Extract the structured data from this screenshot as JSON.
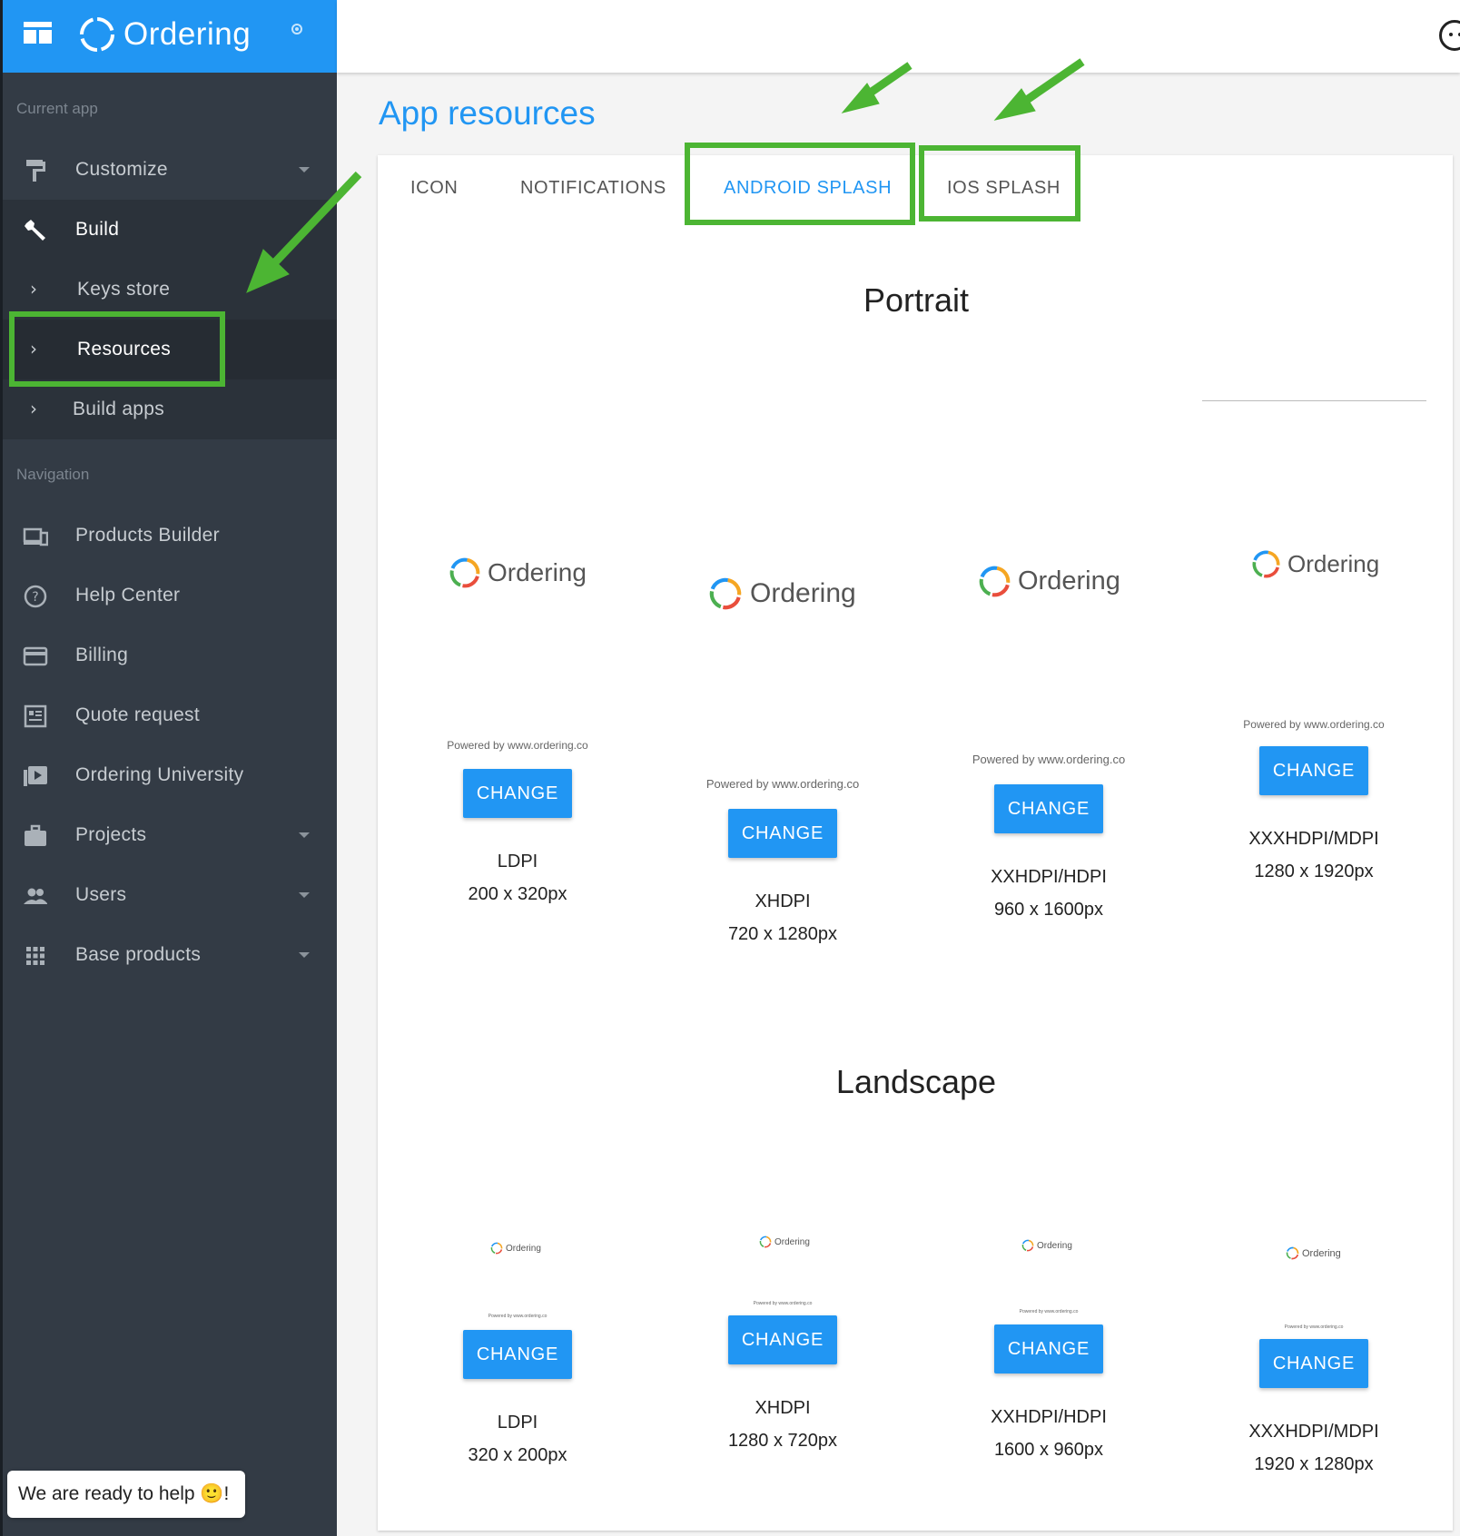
{
  "brand": {
    "name": "Ordering"
  },
  "sidebar": {
    "current_app_label": "Current app",
    "customize": "Customize",
    "build": "Build",
    "build_sub": [
      "Keys store",
      "Resources",
      "Build apps"
    ],
    "navigation_label": "Navigation",
    "nav_items": [
      "Products Builder",
      "Help Center",
      "Billing",
      "Quote request",
      "Ordering University",
      "Projects",
      "Users",
      "Base products"
    ]
  },
  "help_bubble": "We are ready to help 🙂!",
  "page": {
    "title": "App resources"
  },
  "tabs": [
    "ICON",
    "NOTIFICATIONS",
    "ANDROID SPLASH",
    "IOS SPLASH"
  ],
  "active_tab": "ANDROID SPLASH",
  "portrait": {
    "title": "Portrait",
    "tiles": [
      {
        "logo": "Ordering",
        "powered": "Powered by www.ordering.co",
        "button": "CHANGE",
        "density": "LDPI",
        "size": "200 x 320px"
      },
      {
        "logo": "Ordering",
        "powered": "Powered by www.ordering.co",
        "button": "CHANGE",
        "density": "XHDPI",
        "size": "720 x 1280px"
      },
      {
        "logo": "Ordering",
        "powered": "Powered by www.ordering.co",
        "button": "CHANGE",
        "density": "XXHDPI/HDPI",
        "size": "960 x 1600px"
      },
      {
        "logo": "Ordering",
        "powered": "Powered by www.ordering.co",
        "button": "CHANGE",
        "density": "XXXHDPI/MDPI",
        "size": "1280 x 1920px"
      }
    ]
  },
  "landscape": {
    "title": "Landscape",
    "tiles": [
      {
        "logo": "Ordering",
        "powered": "Powered by www.ordering.co",
        "button": "CHANGE",
        "density": "LDPI",
        "size": "320 x 200px"
      },
      {
        "logo": "Ordering",
        "powered": "Powered by www.ordering.co",
        "button": "CHANGE",
        "density": "XHDPI",
        "size": "1280 x 720px"
      },
      {
        "logo": "Ordering",
        "powered": "Powered by www.ordering.co",
        "button": "CHANGE",
        "density": "XXHDPI/HDPI",
        "size": "1600 x 960px"
      },
      {
        "logo": "Ordering",
        "powered": "Powered by www.ordering.co",
        "button": "CHANGE",
        "density": "XXXHDPI/MDPI",
        "size": "1920 x 1280px"
      }
    ]
  },
  "colors": {
    "accent": "#2196f3",
    "sidebar": "#333b45",
    "highlight": "#4cb533"
  },
  "icons": {
    "menu": "dashboard-icon",
    "customize": "paint-roller-icon",
    "build": "wrench-icon",
    "profile": "face-icon"
  }
}
